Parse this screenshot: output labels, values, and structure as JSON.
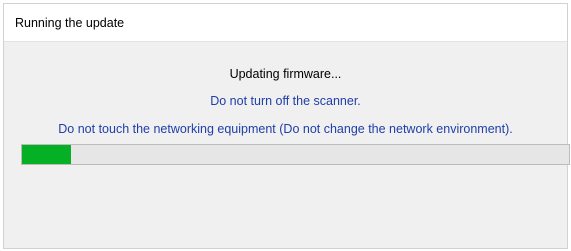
{
  "window": {
    "title": "Running the update"
  },
  "dialog": {
    "status_message": "Updating firmware...",
    "warning_scanner": "Do not turn off the scanner.",
    "warning_network": "Do not touch the networking equipment (Do not change the network environment)."
  },
  "progress": {
    "percent": 9,
    "fill_color": "#06b025"
  },
  "colors": {
    "warning_text": "#1f3ea8",
    "dialog_background": "#f0f0f0"
  }
}
